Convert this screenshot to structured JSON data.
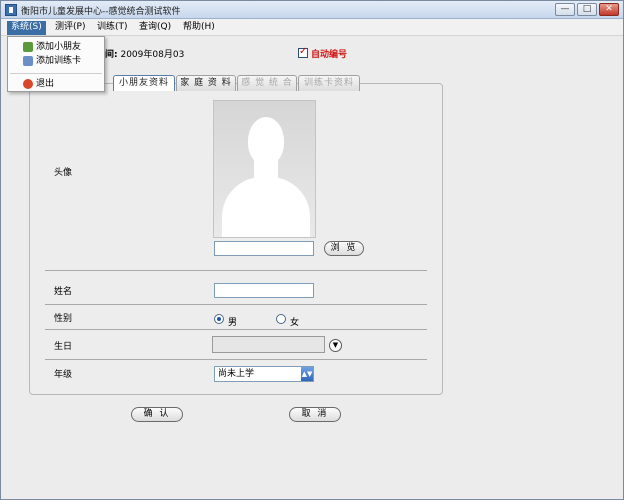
{
  "window": {
    "title": "衡阳市儿童发展中心--感觉统合测试软件",
    "controls": [
      "—",
      "□",
      "✕"
    ]
  },
  "menubar": {
    "items": [
      {
        "label": "系统(S)"
      },
      {
        "label": "测评(P)"
      },
      {
        "label": "训练(T)"
      },
      {
        "label": "查询(Q)"
      },
      {
        "label": "帮助(H)"
      }
    ]
  },
  "dropdown": {
    "items": [
      {
        "label": "添加小朋友",
        "icon": "child-add-icon"
      },
      {
        "label": "添加训练卡",
        "icon": "card-add-icon"
      },
      {
        "label": "退出",
        "icon": "exit-icon"
      }
    ]
  },
  "header": {
    "date_label": "评时间:",
    "date_value": "2009年08月03",
    "auto_number_label": "自动编号",
    "auto_number_checked": true
  },
  "tabs": [
    {
      "label": "小朋友资料",
      "state": "active"
    },
    {
      "label": "家 庭 资 料",
      "state": "normal"
    },
    {
      "label": "感 觉 统 合",
      "state": "disabled"
    },
    {
      "label": "训练卡资料",
      "state": "disabled"
    }
  ],
  "form": {
    "avatar_label": "头像",
    "photo_path_value": "",
    "browse_label": "浏 览",
    "name_label": "姓名",
    "name_value": "",
    "gender_label": "性别",
    "gender_male": "男",
    "gender_female": "女",
    "gender_selected": "男",
    "birthday_label": "生日",
    "birthday_value": "",
    "grade_label": "年级",
    "grade_value": "尚未上学"
  },
  "actions": {
    "confirm_label": "确 认",
    "cancel_label": "取 消"
  },
  "colors": {
    "accent": "#3a6ea5",
    "auto_number_text": "#d01818"
  }
}
